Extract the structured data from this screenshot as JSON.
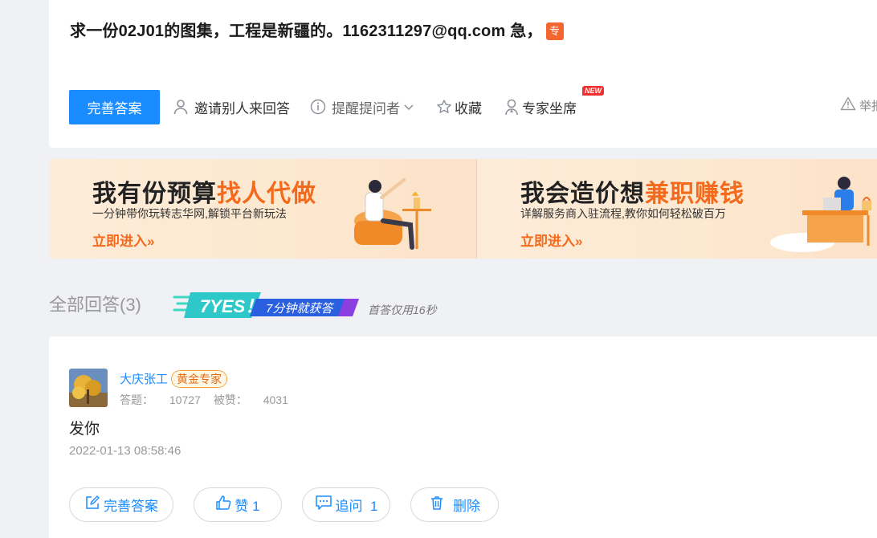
{
  "question": {
    "title": "求一份02J01的图集，工程是新疆的。1162311297@qq.com 急，",
    "badge": "专"
  },
  "actions": {
    "perfect_answer": "完善答案",
    "invite": "邀请别人来回答",
    "remind": "提醒提问者",
    "favorite": "收藏",
    "expert": "专家坐席",
    "new_tag": "NEW",
    "report": "举报"
  },
  "banners": [
    {
      "title_plain": "我有份预算",
      "title_highlight": "找人代做",
      "subtitle": "一分钟带你玩转志华网,解锁平台新玩法",
      "link": "立即进入»"
    },
    {
      "title_plain": "我会造价想",
      "title_highlight": "兼职赚钱",
      "subtitle": "详解服务商入驻流程,教你如何轻松破百万",
      "link": "立即进入»"
    }
  ],
  "answers": {
    "heading": "全部回答(3)",
    "yes_big": "7YES！",
    "yes_small": "7分钟就获答",
    "yes_note": "首答仅用16秒"
  },
  "answer": {
    "username": "大庆张工",
    "level": "黄金专家",
    "answers_label": "答题：",
    "answers_count": "10727",
    "likes_label": "被赞：",
    "likes_count": "4031",
    "text": "发你",
    "time": "2022-01-13 08:58:46",
    "btn_perfect": "完善答案",
    "btn_like": "赞 1",
    "btn_followup": "追问  1",
    "btn_delete": "删除"
  },
  "colors": {
    "primary": "#1a8cff",
    "accent_orange": "#f46a1c",
    "badge_red": "#f03030",
    "page_bg": "#f0f1f5"
  }
}
